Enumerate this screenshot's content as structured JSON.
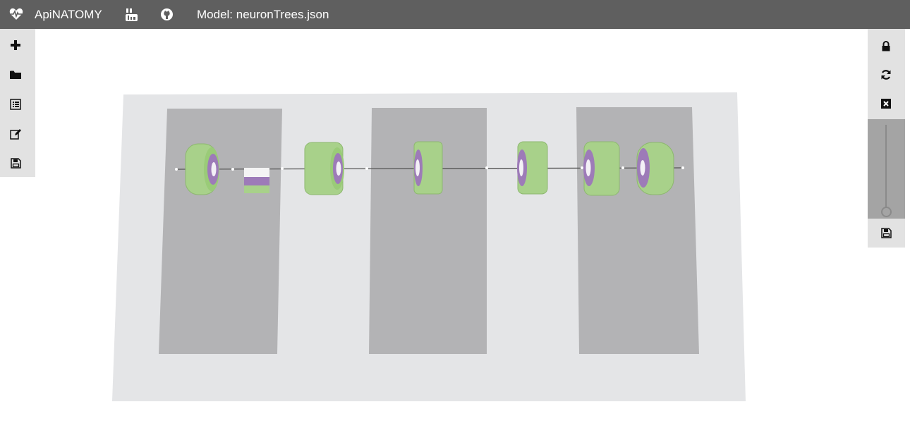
{
  "header": {
    "app_title": "ApiNATOMY",
    "model_label": "Model: neuronTrees.json",
    "icons": [
      "heartbeat-icon",
      "youtube-icon",
      "github-icon"
    ]
  },
  "left_toolbar": {
    "buttons": [
      "plus-icon",
      "folder-icon",
      "list-icon",
      "edit-icon",
      "save-icon"
    ]
  },
  "right_toolbar": {
    "buttons": [
      "lock-icon",
      "refresh-icon",
      "close-icon",
      "save-icon"
    ],
    "slider_value": 0
  },
  "scene": {
    "colors": {
      "background_plane": "#e4e5e7",
      "panels": "#b3b3b5",
      "lyph_outer": "#a8d18a",
      "lyph_inner": "#9d7bb8",
      "link": "#555555"
    }
  }
}
